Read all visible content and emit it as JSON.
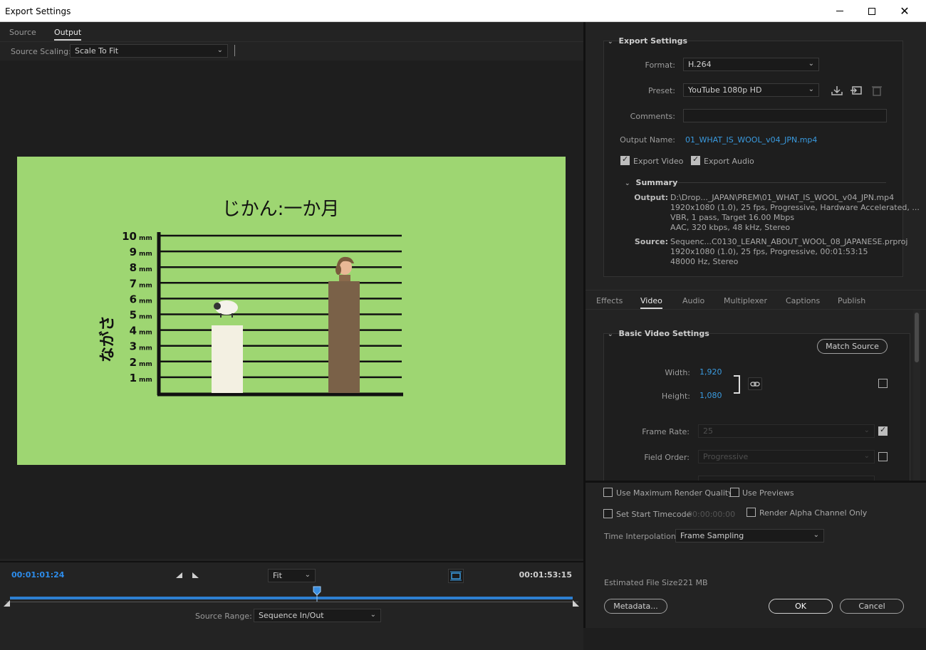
{
  "window": {
    "title": "Export Settings"
  },
  "left": {
    "tabs": [
      {
        "label": "Source"
      },
      {
        "label": "Output"
      }
    ],
    "source_scaling_label": "Source Scaling:",
    "source_scaling_value": "Scale To Fit",
    "preview": {
      "title": "じかん:一か月",
      "ylabel": "ながさ",
      "unit": "mm",
      "ticks": [
        "10",
        "9",
        "8",
        "7",
        "6",
        "5",
        "4",
        "3",
        "2",
        "1"
      ]
    },
    "timeline": {
      "in_timecode": "00:01:01:24",
      "out_timecode": "00:01:53:15",
      "zoom_value": "Fit",
      "source_range_label": "Source Range:",
      "source_range_value": "Sequence In/Out",
      "playhead_fraction": 0.546
    }
  },
  "right": {
    "export_settings": {
      "heading": "Export Settings",
      "format_label": "Format:",
      "format_value": "H.264",
      "preset_label": "Preset:",
      "preset_value": "YouTube 1080p HD",
      "comments_label": "Comments:",
      "comments_value": "",
      "output_name_label": "Output Name:",
      "output_name_value": "01_WHAT_IS_WOOL_v04_JPN.mp4",
      "export_video_label": "Export Video",
      "export_audio_label": "Export Audio"
    },
    "summary": {
      "heading": "Summary",
      "output_key": "Output:",
      "output_lines": [
        "D:\\Drop..._JAPAN\\PREM\\01_WHAT_IS_WOOL_v04_JPN.mp4",
        "1920x1080 (1.0), 25 fps, Progressive, Hardware Accelerated, ...",
        "VBR, 1 pass, Target 16.00 Mbps",
        "AAC, 320 kbps, 48 kHz, Stereo"
      ],
      "source_key": "Source:",
      "source_lines": [
        "Sequenc...C0130_LEARN_ABOUT_WOOL_08_JAPANESE.prproj",
        "1920x1080 (1.0), 25 fps, Progressive, 00:01:53:15",
        "48000 Hz, Stereo"
      ]
    },
    "tabs": [
      {
        "label": "Effects"
      },
      {
        "label": "Video"
      },
      {
        "label": "Audio"
      },
      {
        "label": "Multiplexer"
      },
      {
        "label": "Captions"
      },
      {
        "label": "Publish"
      }
    ],
    "basic_video": {
      "heading": "Basic Video Settings",
      "match_source_label": "Match Source",
      "width_label": "Width:",
      "width_value": "1,920",
      "height_label": "Height:",
      "height_value": "1,080",
      "frame_rate_label": "Frame Rate:",
      "frame_rate_value": "25",
      "field_order_label": "Field Order:",
      "field_order_value": "Progressive"
    },
    "options": {
      "max_render_label": "Use Maximum Render Quality",
      "use_previews_label": "Use Previews",
      "start_timecode_label": "Set Start Timecode",
      "start_timecode_value": "00:00:00:00",
      "alpha_label": "Render Alpha Channel Only",
      "time_interp_label": "Time Interpolation:",
      "time_interp_value": "Frame Sampling",
      "file_size_label": "Estimated File Size:",
      "file_size_value": "221 MB"
    },
    "buttons": {
      "metadata": "Metadata...",
      "ok": "OK",
      "cancel": "Cancel"
    }
  }
}
